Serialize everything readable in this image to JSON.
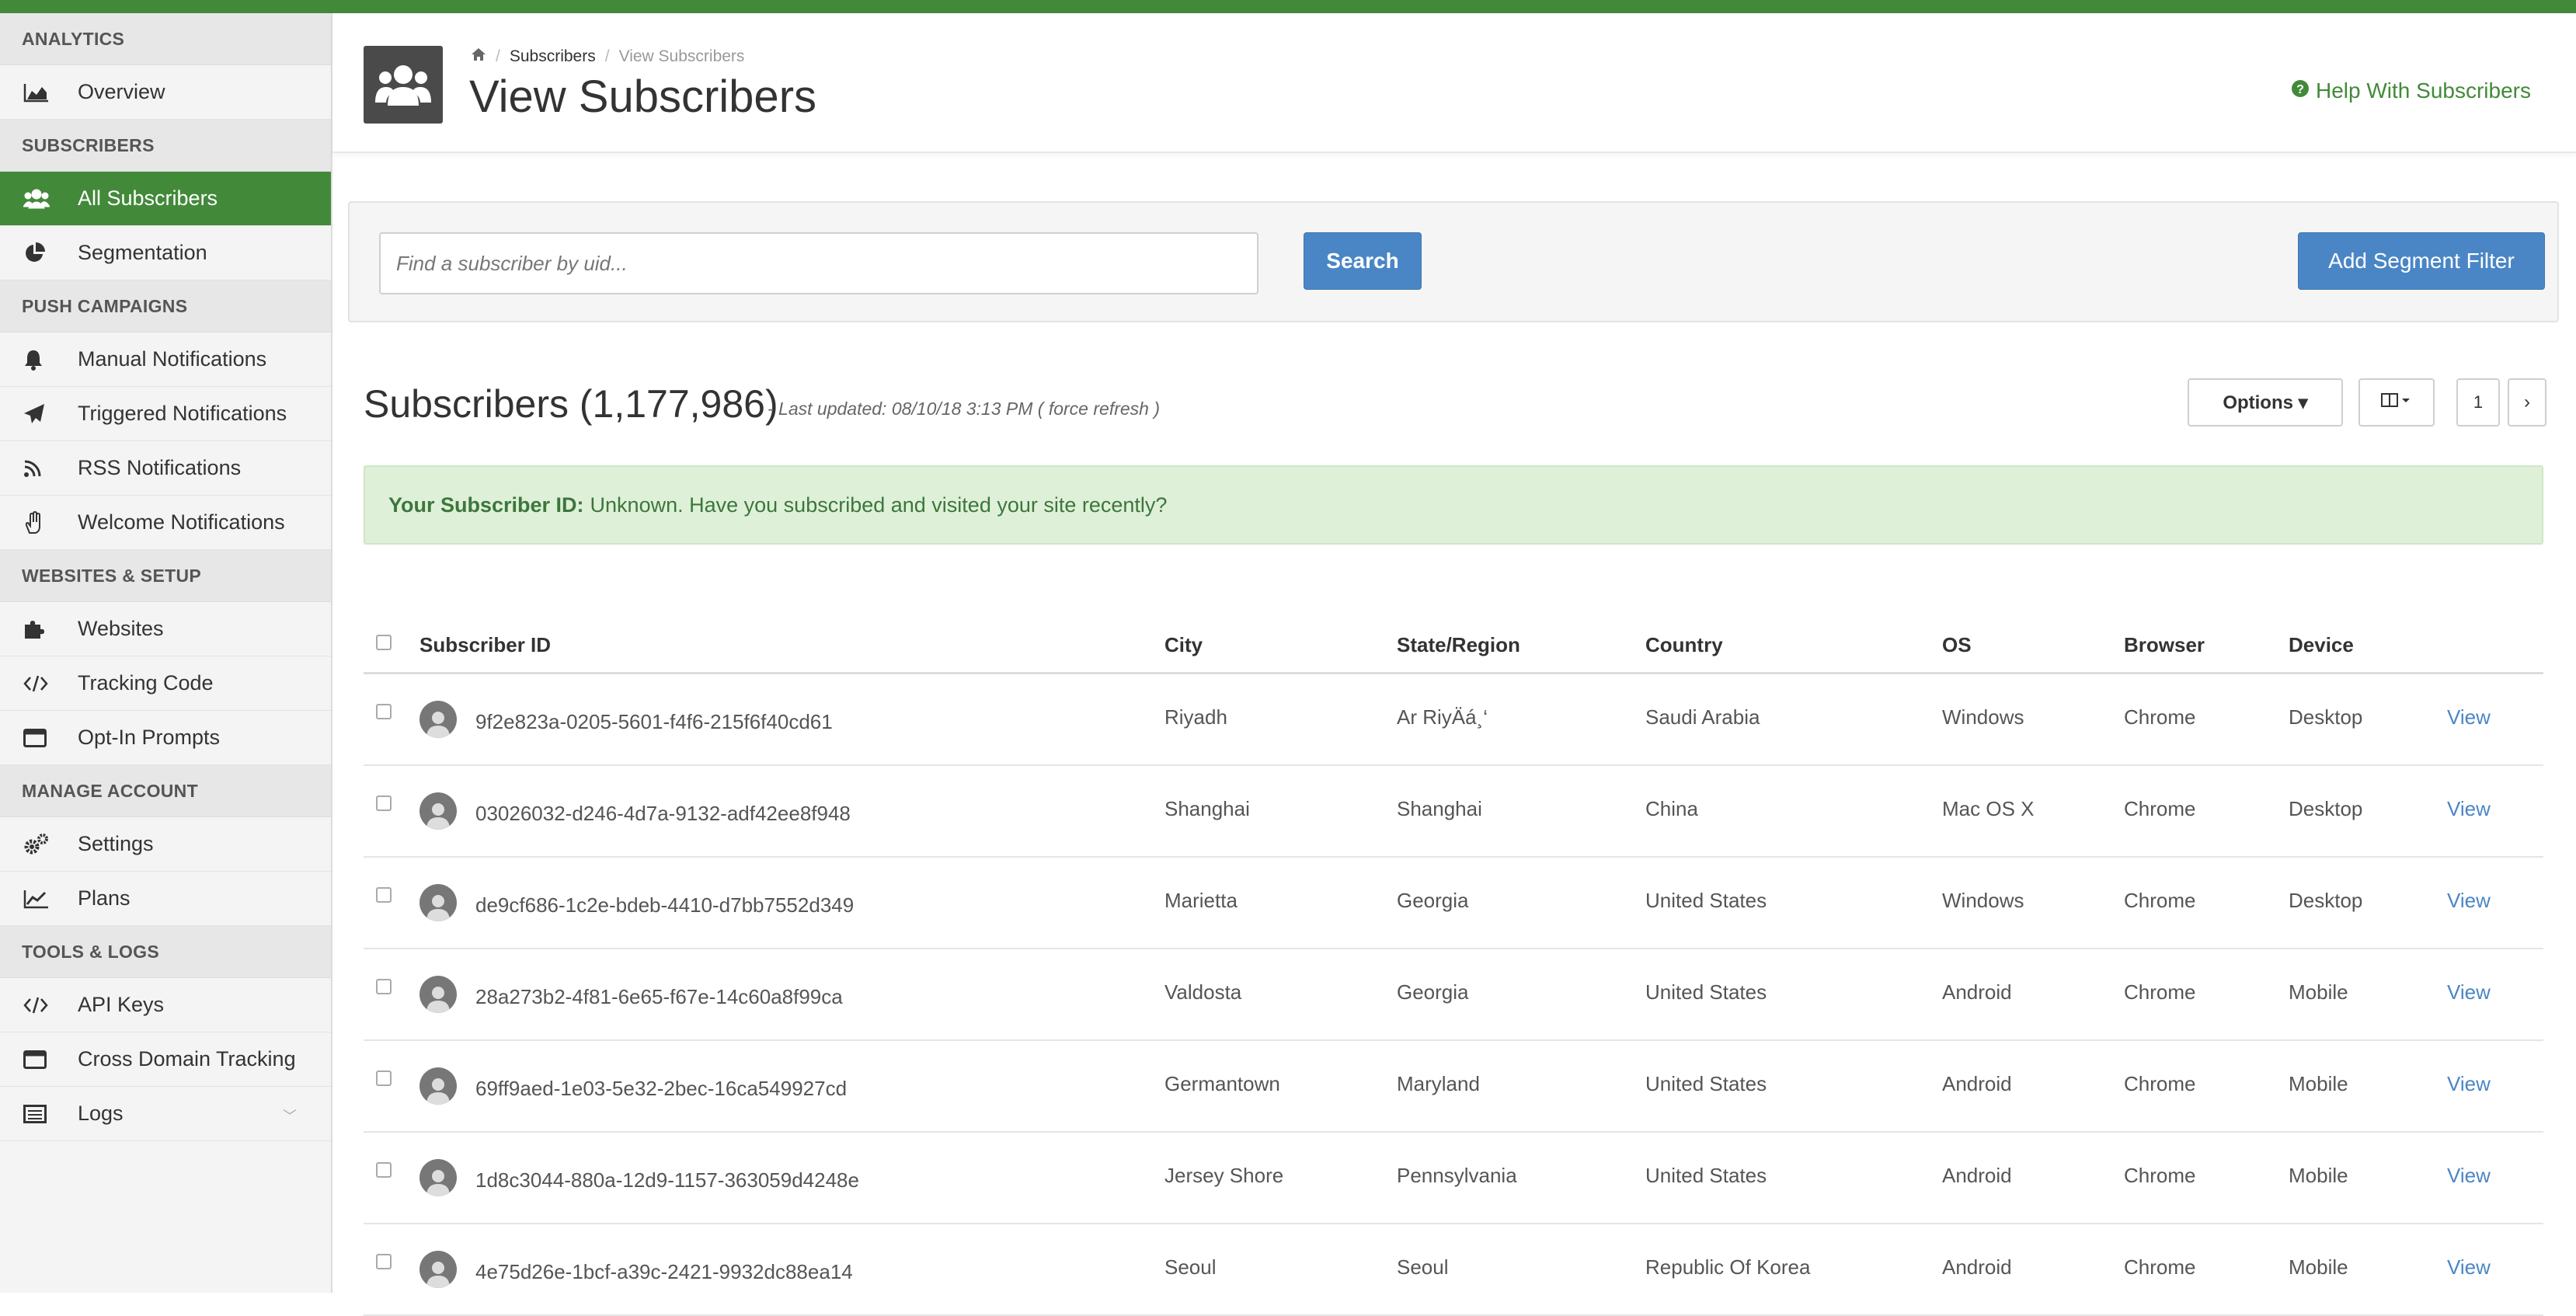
{
  "sidebar": {
    "sections": [
      {
        "header": "ANALYTICS",
        "items": [
          {
            "label": "Overview",
            "icon": "area-chart-icon"
          }
        ]
      },
      {
        "header": "SUBSCRIBERS",
        "items": [
          {
            "label": "All Subscribers",
            "icon": "users-icon",
            "active": true
          },
          {
            "label": "Segmentation",
            "icon": "pie-chart-icon"
          }
        ]
      },
      {
        "header": "PUSH CAMPAIGNS",
        "items": [
          {
            "label": "Manual Notifications",
            "icon": "bell-icon"
          },
          {
            "label": "Triggered Notifications",
            "icon": "paper-plane-icon"
          },
          {
            "label": "RSS Notifications",
            "icon": "rss-icon"
          },
          {
            "label": "Welcome Notifications",
            "icon": "hand-wave-icon"
          }
        ]
      },
      {
        "header": "WEBSITES & SETUP",
        "items": [
          {
            "label": "Websites",
            "icon": "puzzle-icon"
          },
          {
            "label": "Tracking Code",
            "icon": "code-icon"
          },
          {
            "label": "Opt-In Prompts",
            "icon": "window-icon"
          }
        ]
      },
      {
        "header": "MANAGE ACCOUNT",
        "items": [
          {
            "label": "Settings",
            "icon": "gears-icon"
          },
          {
            "label": "Plans",
            "icon": "line-chart-icon"
          }
        ]
      },
      {
        "header": "TOOLS & LOGS",
        "items": [
          {
            "label": "API Keys",
            "icon": "code-icon"
          },
          {
            "label": "Cross Domain Tracking",
            "icon": "window-icon"
          },
          {
            "label": "Logs",
            "icon": "list-icon"
          }
        ]
      }
    ]
  },
  "header": {
    "breadcrumb": {
      "home_icon": "home-icon",
      "item1": "Subscribers",
      "current": "View Subscribers"
    },
    "title": "View Subscribers",
    "help": "Help With Subscribers"
  },
  "search": {
    "placeholder": "Find a subscriber by uid...",
    "button": "Search",
    "segment_button": "Add Segment Filter"
  },
  "list": {
    "title": "Subscribers (1,177,986)",
    "meta": "- Last updated: 08/10/18 3:13 PM ( force refresh )",
    "options_button": "Options ▾",
    "page": "1",
    "next": "›"
  },
  "alert": {
    "label": "Your Subscriber ID:",
    "text": "Unknown. Have you subscribed and visited your site recently?"
  },
  "table": {
    "columns": [
      "Subscriber ID",
      "City",
      "State/Region",
      "Country",
      "OS",
      "Browser",
      "Device"
    ],
    "rows": [
      {
        "id": "9f2e823a-0205-5601-f4f6-215f6f40cd61",
        "city": "Riyadh",
        "state": "Ar RiyÄá¸‘",
        "country": "Saudi Arabia",
        "os": "Windows",
        "browser": "Chrome",
        "device": "Desktop",
        "action": "View"
      },
      {
        "id": "03026032-d246-4d7a-9132-adf42ee8f948",
        "city": "Shanghai",
        "state": "Shanghai",
        "country": "China",
        "os": "Mac OS X",
        "browser": "Chrome",
        "device": "Desktop",
        "action": "View"
      },
      {
        "id": "de9cf686-1c2e-bdeb-4410-d7bb7552d349",
        "city": "Marietta",
        "state": "Georgia",
        "country": "United States",
        "os": "Windows",
        "browser": "Chrome",
        "device": "Desktop",
        "action": "View"
      },
      {
        "id": "28a273b2-4f81-6e65-f67e-14c60a8f99ca",
        "city": "Valdosta",
        "state": "Georgia",
        "country": "United States",
        "os": "Android",
        "browser": "Chrome",
        "device": "Mobile",
        "action": "View"
      },
      {
        "id": "69ff9aed-1e03-5e32-2bec-16ca549927cd",
        "city": "Germantown",
        "state": "Maryland",
        "country": "United States",
        "os": "Android",
        "browser": "Chrome",
        "device": "Mobile",
        "action": "View"
      },
      {
        "id": "1d8c3044-880a-12d9-1157-363059d4248e",
        "city": "Jersey Shore",
        "state": "Pennsylvania",
        "country": "United States",
        "os": "Android",
        "browser": "Chrome",
        "device": "Mobile",
        "action": "View"
      },
      {
        "id": "4e75d26e-1bcf-a39c-2421-9932dc88ea14",
        "city": "Seoul",
        "state": "Seoul",
        "country": "Republic Of Korea",
        "os": "Android",
        "browser": "Chrome",
        "device": "Mobile",
        "action": "View"
      }
    ]
  },
  "colors": {
    "brand_green": "#43893a",
    "button_blue": "#4a86c5",
    "alert_bg": "#dff0d8"
  }
}
